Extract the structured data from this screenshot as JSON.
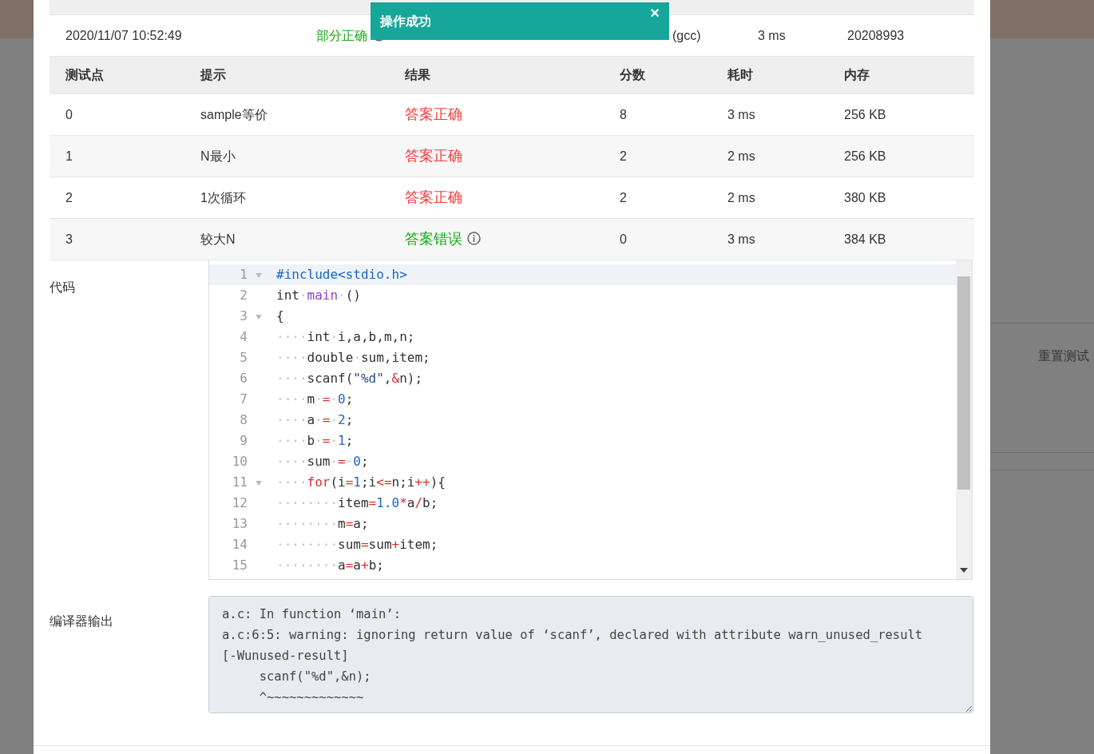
{
  "background": {
    "side_text": "重置测试"
  },
  "toast": {
    "message": "操作成功",
    "close": "×"
  },
  "submission": {
    "row": {
      "time": "2020/11/07 10:52:49",
      "status": "部分正确",
      "info": true,
      "compiler": "(gcc)",
      "duration": "3 ms",
      "user": "20208993"
    }
  },
  "tests": {
    "columns": [
      "测试点",
      "提示",
      "结果",
      "分数",
      "耗时",
      "内存"
    ],
    "rows": [
      {
        "id": "0",
        "hint": "sample等价",
        "result": "答案正确",
        "color": "#f23d3d",
        "info": false,
        "score": "8",
        "time": "3 ms",
        "memory": "256 KB"
      },
      {
        "id": "1",
        "hint": "N最小",
        "result": "答案正确",
        "color": "#f23d3d",
        "info": false,
        "score": "2",
        "time": "2 ms",
        "memory": "256 KB"
      },
      {
        "id": "2",
        "hint": "1次循环",
        "result": "答案正确",
        "color": "#f23d3d",
        "info": false,
        "score": "2",
        "time": "2 ms",
        "memory": "380 KB"
      },
      {
        "id": "3",
        "hint": "较大N",
        "result": "答案错误",
        "color": "#19aa19",
        "info": true,
        "score": "0",
        "time": "3 ms",
        "memory": "384 KB"
      }
    ]
  },
  "code": {
    "label": "代码",
    "lines": [
      {
        "number": "1",
        "fold": true,
        "active": true,
        "tokens": [
          {
            "t": "#include<stdio.h>",
            "kind": "meta"
          }
        ]
      },
      {
        "number": "2",
        "fold": false,
        "active": false,
        "tokens": [
          {
            "t": "int",
            "kind": "plain"
          },
          {
            "t": "·",
            "kind": "ws"
          },
          {
            "t": "main",
            "kind": "func"
          },
          {
            "t": "·",
            "kind": "ws"
          },
          {
            "t": "()",
            "kind": "plain"
          }
        ]
      },
      {
        "number": "3",
        "fold": true,
        "active": false,
        "tokens": [
          {
            "t": "{",
            "kind": "plain"
          }
        ]
      },
      {
        "number": "4",
        "fold": false,
        "active": false,
        "tokens": [
          {
            "t": "····",
            "kind": "ws"
          },
          {
            "t": "int",
            "kind": "plain"
          },
          {
            "t": "·",
            "kind": "ws"
          },
          {
            "t": "i,a,b,m,n;",
            "kind": "plain"
          }
        ]
      },
      {
        "number": "5",
        "fold": false,
        "active": false,
        "tokens": [
          {
            "t": "····",
            "kind": "ws"
          },
          {
            "t": "double",
            "kind": "plain"
          },
          {
            "t": "·",
            "kind": "ws"
          },
          {
            "t": "sum,item;",
            "kind": "plain"
          }
        ]
      },
      {
        "number": "6",
        "fold": false,
        "active": false,
        "tokens": [
          {
            "t": "····",
            "kind": "ws"
          },
          {
            "t": "scanf(",
            "kind": "plain"
          },
          {
            "t": "\"%d\"",
            "kind": "str"
          },
          {
            "t": ",",
            "kind": "plain"
          },
          {
            "t": "&",
            "kind": "op"
          },
          {
            "t": "n);",
            "kind": "plain"
          }
        ]
      },
      {
        "number": "7",
        "fold": false,
        "active": false,
        "tokens": [
          {
            "t": "····",
            "kind": "ws"
          },
          {
            "t": "m",
            "kind": "plain"
          },
          {
            "t": "·",
            "kind": "ws"
          },
          {
            "t": "=",
            "kind": "op"
          },
          {
            "t": "·",
            "kind": "ws"
          },
          {
            "t": "0",
            "kind": "num"
          },
          {
            "t": ";",
            "kind": "plain"
          }
        ]
      },
      {
        "number": "8",
        "fold": false,
        "active": false,
        "tokens": [
          {
            "t": "····",
            "kind": "ws"
          },
          {
            "t": "a",
            "kind": "plain"
          },
          {
            "t": "·",
            "kind": "ws"
          },
          {
            "t": "=",
            "kind": "op"
          },
          {
            "t": "·",
            "kind": "ws"
          },
          {
            "t": "2",
            "kind": "num"
          },
          {
            "t": ";",
            "kind": "plain"
          }
        ]
      },
      {
        "number": "9",
        "fold": false,
        "active": false,
        "tokens": [
          {
            "t": "····",
            "kind": "ws"
          },
          {
            "t": "b",
            "kind": "plain"
          },
          {
            "t": "·",
            "kind": "ws"
          },
          {
            "t": "=",
            "kind": "op"
          },
          {
            "t": "·",
            "kind": "ws"
          },
          {
            "t": "1",
            "kind": "num"
          },
          {
            "t": ";",
            "kind": "plain"
          }
        ]
      },
      {
        "number": "10",
        "fold": false,
        "active": false,
        "tokens": [
          {
            "t": "····",
            "kind": "ws"
          },
          {
            "t": "sum",
            "kind": "plain"
          },
          {
            "t": "·",
            "kind": "ws"
          },
          {
            "t": "=",
            "kind": "op"
          },
          {
            "t": "·",
            "kind": "ws"
          },
          {
            "t": "0",
            "kind": "num"
          },
          {
            "t": ";",
            "kind": "plain"
          }
        ]
      },
      {
        "number": "11",
        "fold": true,
        "active": false,
        "tokens": [
          {
            "t": "····",
            "kind": "ws"
          },
          {
            "t": "for",
            "kind": "kw"
          },
          {
            "t": "(i",
            "kind": "plain"
          },
          {
            "t": "=",
            "kind": "op"
          },
          {
            "t": "1",
            "kind": "num"
          },
          {
            "t": ";i",
            "kind": "plain"
          },
          {
            "t": "<=",
            "kind": "op"
          },
          {
            "t": "n;i",
            "kind": "plain"
          },
          {
            "t": "++",
            "kind": "op"
          },
          {
            "t": "){",
            "kind": "plain"
          }
        ]
      },
      {
        "number": "12",
        "fold": false,
        "active": false,
        "tokens": [
          {
            "t": "········",
            "kind": "ws"
          },
          {
            "t": "item",
            "kind": "plain"
          },
          {
            "t": "=",
            "kind": "op"
          },
          {
            "t": "1.0",
            "kind": "num"
          },
          {
            "t": "*",
            "kind": "op"
          },
          {
            "t": "a",
            "kind": "plain"
          },
          {
            "t": "/",
            "kind": "op"
          },
          {
            "t": "b;",
            "kind": "plain"
          }
        ]
      },
      {
        "number": "13",
        "fold": false,
        "active": false,
        "tokens": [
          {
            "t": "········",
            "kind": "ws"
          },
          {
            "t": "m",
            "kind": "plain"
          },
          {
            "t": "=",
            "kind": "op"
          },
          {
            "t": "a;",
            "kind": "plain"
          }
        ]
      },
      {
        "number": "14",
        "fold": false,
        "active": false,
        "tokens": [
          {
            "t": "········",
            "kind": "ws"
          },
          {
            "t": "sum",
            "kind": "plain"
          },
          {
            "t": "=",
            "kind": "op"
          },
          {
            "t": "sum",
            "kind": "plain"
          },
          {
            "t": "+",
            "kind": "op"
          },
          {
            "t": "item;",
            "kind": "plain"
          }
        ]
      },
      {
        "number": "15",
        "fold": false,
        "active": false,
        "tokens": [
          {
            "t": "········",
            "kind": "ws"
          },
          {
            "t": "a",
            "kind": "plain"
          },
          {
            "t": "=",
            "kind": "op"
          },
          {
            "t": "a",
            "kind": "plain"
          },
          {
            "t": "+",
            "kind": "op"
          },
          {
            "t": "b;",
            "kind": "plain"
          }
        ]
      }
    ]
  },
  "compiler_output": {
    "label": "编译器输出",
    "value": "a.c: In function ‘main’:\na.c:6:5: warning: ignoring return value of ‘scanf’, declared with attribute warn_unused_result\n[-Wunused-result]\n     scanf(\"%d\",&n);\n     ^~~~~~~~~~~~~~"
  }
}
